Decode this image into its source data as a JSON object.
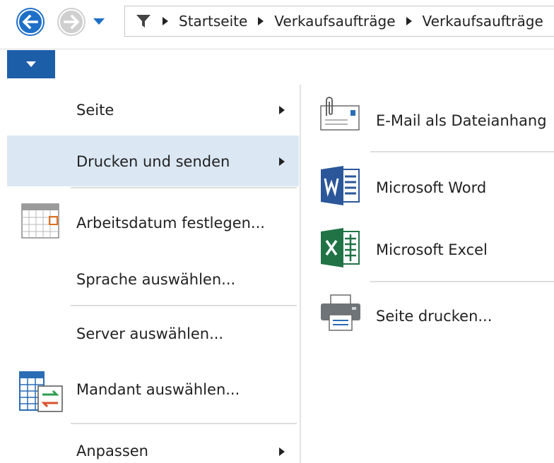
{
  "breadcrumb": [
    "Startseite",
    "Verkaufsaufträge",
    "Verkaufsaufträge"
  ],
  "menu": {
    "items": [
      {
        "label": "Seite"
      },
      {
        "label": "Drucken und senden"
      },
      {
        "label": "Arbeitsdatum festlegen..."
      },
      {
        "label": "Sprache auswählen..."
      },
      {
        "label": "Server auswählen..."
      },
      {
        "label": "Mandant auswählen..."
      },
      {
        "label": "Anpassen"
      }
    ]
  },
  "submenu": {
    "items": [
      {
        "label": "E-Mail als Dateianhang",
        "icon": "email-attachment-icon"
      },
      {
        "label": "Microsoft Word",
        "icon": "microsoft-word-icon"
      },
      {
        "label": "Microsoft Excel",
        "icon": "microsoft-excel-icon"
      },
      {
        "label": "Seite drucken...",
        "icon": "printer-icon"
      }
    ]
  },
  "colors": {
    "back_button": "#1e6fc8",
    "forward_button": "#cfcfcf",
    "menu_button": "#1c5ea8",
    "highlight": "#dbe8f4",
    "word": "#2b579a",
    "excel": "#217346"
  }
}
